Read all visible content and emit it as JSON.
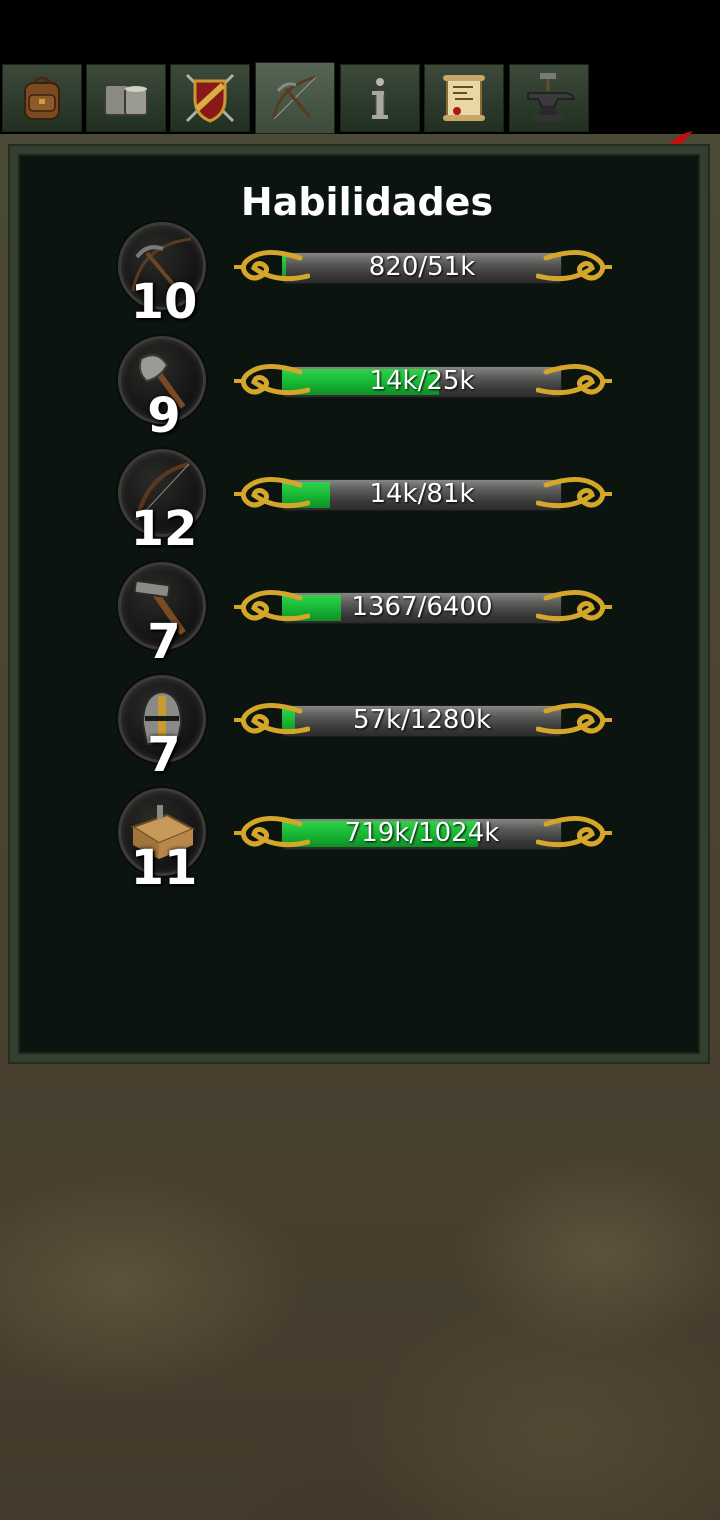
{
  "tabs": [
    {
      "icon": "backpack-icon"
    },
    {
      "icon": "tankard-icon"
    },
    {
      "icon": "shield-swords-icon"
    },
    {
      "icon": "skills-tools-icon",
      "active": true
    },
    {
      "icon": "info-icon"
    },
    {
      "icon": "scroll-map-icon"
    },
    {
      "icon": "anvil-icon"
    }
  ],
  "close_icon": "close-x-icon",
  "panel": {
    "title": "Habilidades"
  },
  "skills": [
    {
      "icon": "pickaxe-bow-icon",
      "level": "10",
      "progress_text": "820/51k",
      "progress": 0.016
    },
    {
      "icon": "axe-icon",
      "level": "9",
      "progress_text": "14k/25k",
      "progress": 0.56
    },
    {
      "icon": "bow-icon",
      "level": "12",
      "progress_text": "14k/81k",
      "progress": 0.17
    },
    {
      "icon": "hammer-icon",
      "level": "7",
      "progress_text": "1367/6400",
      "progress": 0.21
    },
    {
      "icon": "helmet-icon",
      "level": "7",
      "progress_text": "57k/1280k",
      "progress": 0.045
    },
    {
      "icon": "workbench-icon",
      "level": "11",
      "progress_text": "719k/1024k",
      "progress": 0.7
    }
  ],
  "colors": {
    "bar_fill": "#18b835",
    "gold_cap": "#d4a62a",
    "panel_bg": "#0c140f",
    "close": "#d01818"
  }
}
